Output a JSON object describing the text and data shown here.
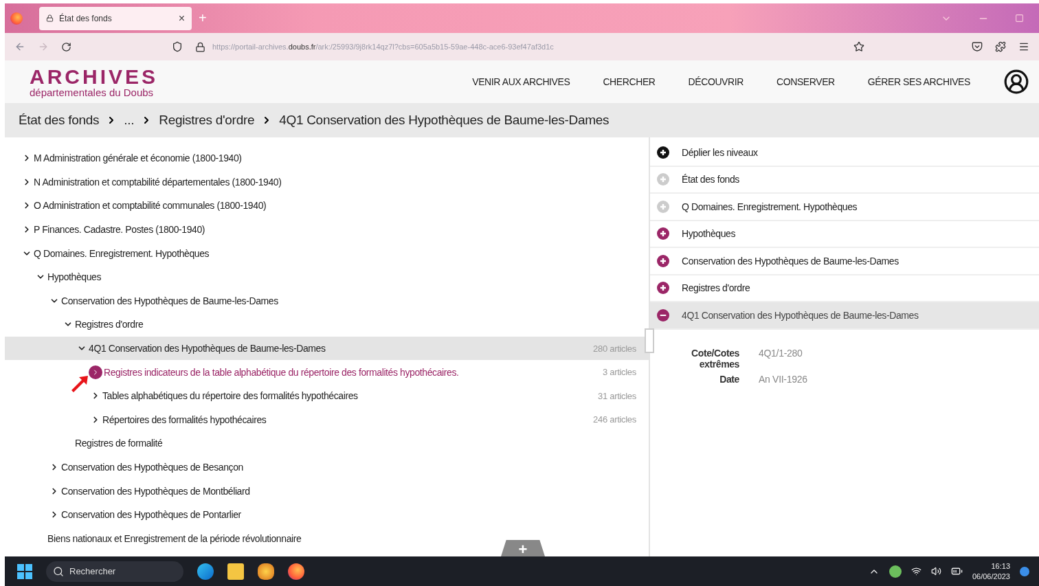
{
  "browser": {
    "tab": {
      "title": "État des fonds",
      "close": "×"
    },
    "new_tab": "+",
    "url_prefix": "https://portail-archives.",
    "url_domain": "doubs.fr",
    "url_path": "/ark:/25993/9j8rk14qz7l?cbs=605a5b15-59ae-448c-ace6-93ef47af3d1c"
  },
  "site": {
    "logo_title": "ARCHIVES",
    "logo_subtitle": "départementales du Doubs",
    "nav": [
      "VENIR AUX ARCHIVES",
      "CHERCHER",
      "DÉCOUVRIR",
      "CONSERVER",
      "GÉRER SES ARCHIVES"
    ]
  },
  "breadcrumb": [
    "État des fonds",
    "...",
    "Registres d'ordre",
    "4Q1 Conservation des Hypothèques de Baume-les-Dames"
  ],
  "tree": [
    {
      "label": "M Administration générale et économie (1800-1940)",
      "kind": "node",
      "expanded": false,
      "selected": false
    },
    {
      "label": "N Administration et comptabilité départementales (1800-1940)",
      "kind": "node",
      "expanded": false,
      "selected": false
    },
    {
      "label": "O Administration et comptabilité communales (1800-1940)",
      "kind": "node",
      "expanded": false,
      "selected": false
    },
    {
      "label": "P Finances. Cadastre. Postes (1800-1940)",
      "kind": "node",
      "expanded": false,
      "selected": false
    },
    {
      "label": "Q Domaines. Enregistrement. Hypothèques",
      "kind": "node",
      "expanded": true,
      "selected": false,
      "children": [
        {
          "label": "Hypothèques",
          "kind": "node",
          "expanded": true,
          "selected": false,
          "children": [
            {
              "label": "Conservation des Hypothèques de Baume-les-Dames",
              "kind": "node",
              "expanded": true,
              "selected": false,
              "children": [
                {
                  "label": "Registres d'ordre",
                  "kind": "node",
                  "expanded": true,
                  "selected": false,
                  "children": [
                    {
                      "label": "4Q1 Conservation des Hypothèques de Baume-les-Dames",
                      "kind": "node",
                      "expanded": true,
                      "selected": true,
                      "count": "280 articles",
                      "children": [
                        {
                          "label": "Registres indicateurs de la table alphabétique du répertoire des formalités hypothécaires.",
                          "kind": "link",
                          "selected": false,
                          "count": "3 articles"
                        },
                        {
                          "label": "Tables alphabétiques du répertoire des formalités hypothécaires",
                          "kind": "node",
                          "expanded": false,
                          "selected": false,
                          "count": "31 articles"
                        },
                        {
                          "label": "Répertoires des formalités hypothécaires",
                          "kind": "node",
                          "expanded": false,
                          "selected": false,
                          "count": "246 articles"
                        }
                      ]
                    }
                  ]
                },
                {
                  "label": "Registres de formalité",
                  "kind": "leaf",
                  "selected": false
                }
              ]
            },
            {
              "label": "Conservation des Hypothèques de Besançon",
              "kind": "node",
              "expanded": false,
              "selected": false
            },
            {
              "label": "Conservation des Hypothèques de Montbéliard",
              "kind": "node",
              "expanded": false,
              "selected": false
            },
            {
              "label": "Conservation des Hypothèques de Pontarlier",
              "kind": "node",
              "expanded": false,
              "selected": false
            }
          ]
        },
        {
          "label": "Biens nationaux et Enregistrement de la période révolutionnaire",
          "kind": "leaf",
          "selected": false
        }
      ]
    }
  ],
  "add_tab": "+",
  "panel": {
    "items": [
      {
        "label": "Déplier les niveaux",
        "kind": "expand",
        "selected": false
      },
      {
        "label": "État des fonds",
        "kind": "disabled",
        "selected": false
      },
      {
        "label": "Q Domaines. Enregistrement. Hypothèques",
        "kind": "disabled",
        "selected": false
      },
      {
        "label": "Hypothèques",
        "kind": "plus",
        "selected": false
      },
      {
        "label": "Conservation des Hypothèques de Baume-les-Dames",
        "kind": "plus",
        "selected": false
      },
      {
        "label": "Registres d'ordre",
        "kind": "plus",
        "selected": false
      },
      {
        "label": "4Q1 Conservation des Hypothèques de Baume-les-Dames",
        "kind": "minus",
        "selected": true
      }
    ],
    "details": [
      {
        "label": "Cote/Cotes extrêmes",
        "value": "4Q1/1-280"
      },
      {
        "label": "Date",
        "value": "An VII-1926"
      }
    ]
  },
  "taskbar": {
    "search": "Rechercher",
    "time": "16:13",
    "date": "06/06/2023"
  }
}
